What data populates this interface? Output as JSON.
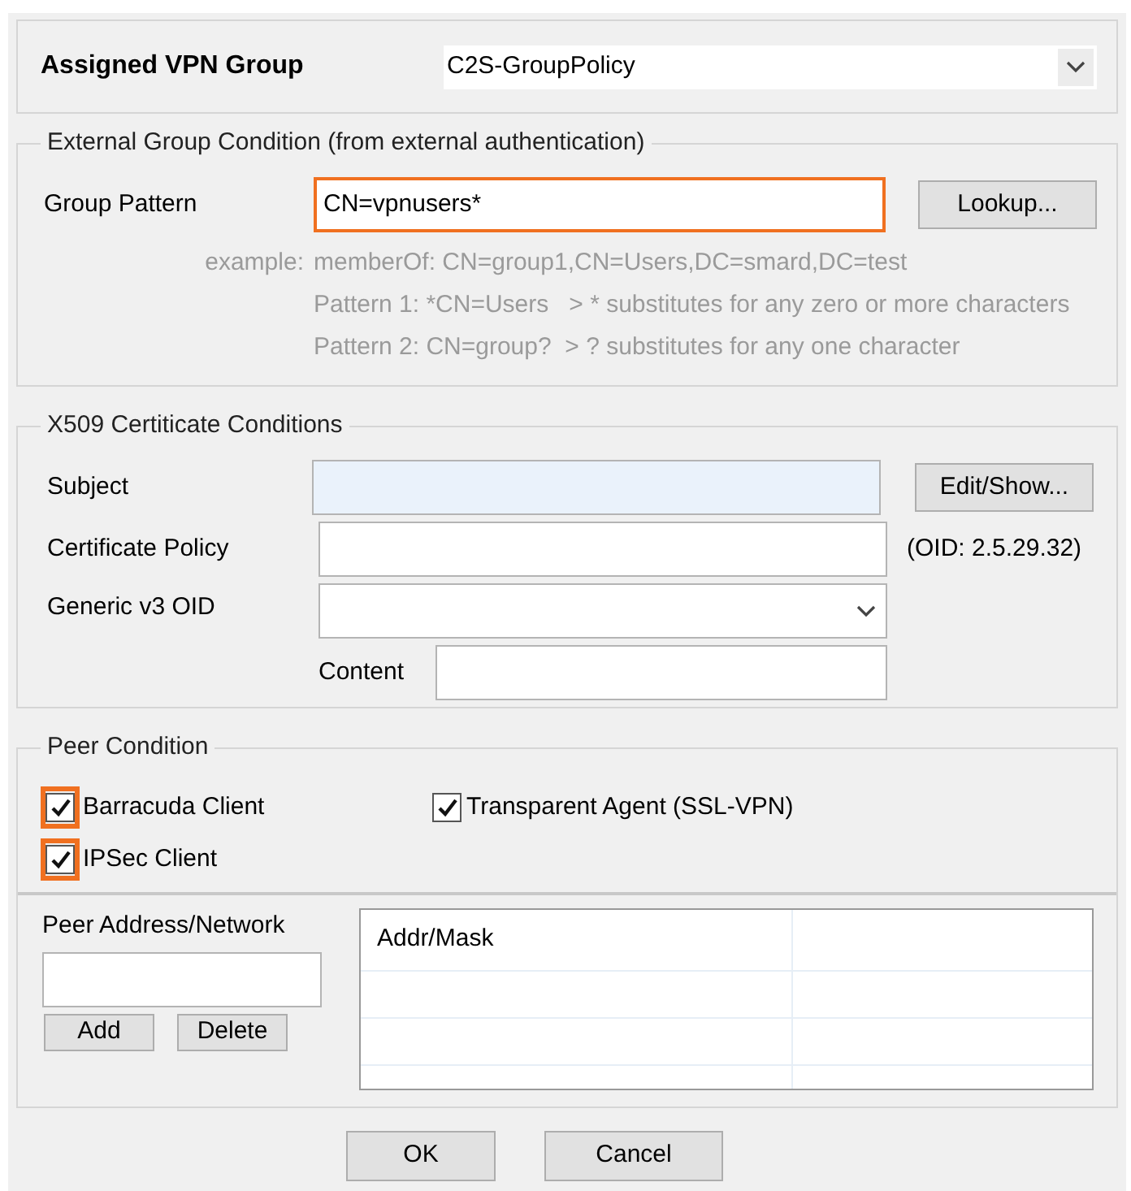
{
  "assigned_group": {
    "label": "Assigned VPN Group",
    "value": "C2S-GroupPolicy"
  },
  "external_group": {
    "title": "External Group Condition (from external authentication)",
    "pattern": {
      "label": "Group Pattern",
      "value": "CN=vpnusers*",
      "highlighted": true
    },
    "lookup_button": "Lookup...",
    "example_label": "example:",
    "example_lines": [
      "memberOf: CN=group1,CN=Users,DC=smard,DC=test",
      "Pattern 1: *CN=Users   > * substitutes for any zero or more characters",
      "Pattern 2: CN=group?  > ? substitutes for any one character"
    ]
  },
  "x509": {
    "title": "X509 Certiticate Conditions",
    "subject": {
      "label": "Subject",
      "focused": true
    },
    "edit_button": "Edit/Show...",
    "policy": {
      "label": "Certificate Policy",
      "note": "(OID: 2.5.29.32)"
    },
    "generic_oid": {
      "label": "Generic v3 OID"
    },
    "content": {
      "label": "Content"
    }
  },
  "peer": {
    "title": "Peer Condition",
    "checkboxes": [
      {
        "label": "Barracuda Client",
        "checked": true,
        "highlighted": true
      },
      {
        "label": "Transparent Agent (SSL-VPN)",
        "checked": true,
        "highlighted": false
      },
      {
        "label": "IPSec Client",
        "checked": true,
        "highlighted": true
      }
    ],
    "address_label": "Peer Address/Network",
    "add_button": "Add",
    "delete_button": "Delete",
    "table": {
      "columns": [
        "Addr/Mask"
      ]
    }
  },
  "buttons": [
    "OK",
    "Cancel"
  ]
}
